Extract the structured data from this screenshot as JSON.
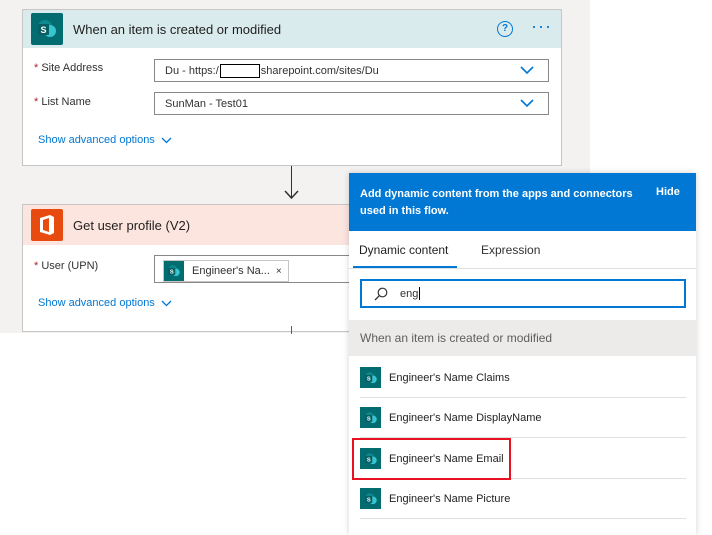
{
  "trigger": {
    "title": "When an item is created or modified",
    "help_icon": "help-icon",
    "more_icon": "more-options-icon",
    "fields": [
      {
        "label": "Site Address",
        "value_prefix": "Du - https:/",
        "value_suffix": "sharepoint.com/sites/Du"
      },
      {
        "label": "List Name",
        "value": "SunMan - Test01"
      }
    ],
    "advanced_label": "Show advanced options"
  },
  "action": {
    "title": "Get user profile (V2)",
    "fields": [
      {
        "label": "User (UPN)",
        "token": "Engineer's Na...",
        "token_remove": "×"
      }
    ],
    "advanced_label": "Show advanced options"
  },
  "dynamic_panel": {
    "header": "Add dynamic content from the apps and connectors used in this flow.",
    "hide_label": "Hide",
    "tabs": [
      "Dynamic content",
      "Expression"
    ],
    "active_tab": "Dynamic content",
    "search_value": "eng",
    "group_title": "When an item is created or modified",
    "items": [
      "Engineer's Name Claims",
      "Engineer's Name DisplayName",
      "Engineer's Name Email",
      "Engineer's Name Picture"
    ],
    "highlighted_item": "Engineer's Name Email"
  },
  "colors": {
    "accent": "#0078d4",
    "sharepoint": "#036c70",
    "office": "#e74b10",
    "highlight": "#e81123"
  }
}
